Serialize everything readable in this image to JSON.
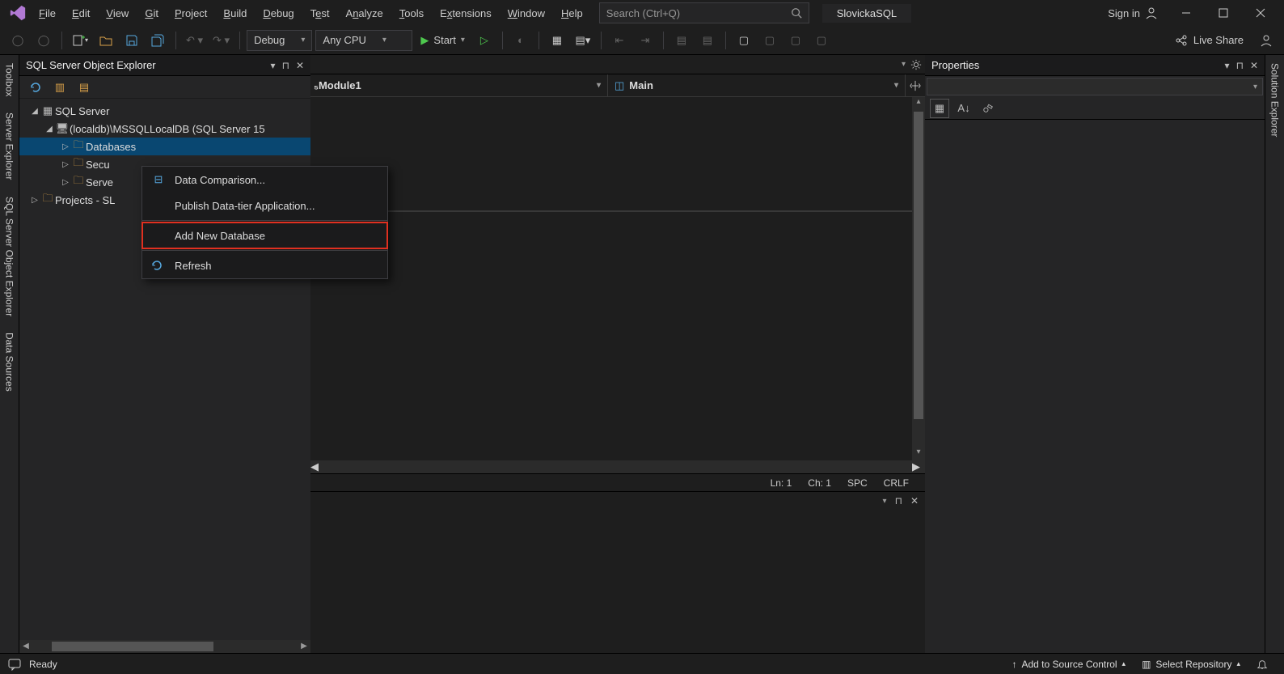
{
  "window": {
    "project": "SlovickaSQL",
    "signin": "Sign in"
  },
  "menu": [
    "File",
    "Edit",
    "View",
    "Git",
    "Project",
    "Build",
    "Debug",
    "Test",
    "Analyze",
    "Tools",
    "Extensions",
    "Window",
    "Help"
  ],
  "search": {
    "placeholder": "Search (Ctrl+Q)"
  },
  "toolbar": {
    "config": "Debug",
    "platform": "Any CPU",
    "start": "Start",
    "liveshare": "Live Share"
  },
  "objexp": {
    "title": "SQL Server Object Explorer",
    "root": "SQL Server",
    "instance": "(localdb)\\MSSQLLocalDB (SQL Server 15",
    "nodes": {
      "databases": "Databases",
      "security": "Secu",
      "server": "Serve"
    },
    "projects": "Projects - SL"
  },
  "context_menu": {
    "data_compare": "Data Comparison...",
    "publish": "Publish Data-tier Application...",
    "add_db": "Add New Database",
    "refresh": "Refresh"
  },
  "editor": {
    "nav_left": "Module1",
    "nav_right": "Main",
    "ln": "Ln: 1",
    "ch": "Ch: 1",
    "insmode": "SPC",
    "eol": "CRLF"
  },
  "properties": {
    "title": "Properties"
  },
  "statusbar": {
    "ready": "Ready",
    "source_ctl": "Add to Source Control",
    "repo": "Select Repository"
  },
  "rail": {
    "left": [
      "Toolbox",
      "Server Explorer",
      "SQL Server Object Explorer",
      "Data Sources"
    ],
    "right": [
      "Solution Explorer"
    ]
  }
}
